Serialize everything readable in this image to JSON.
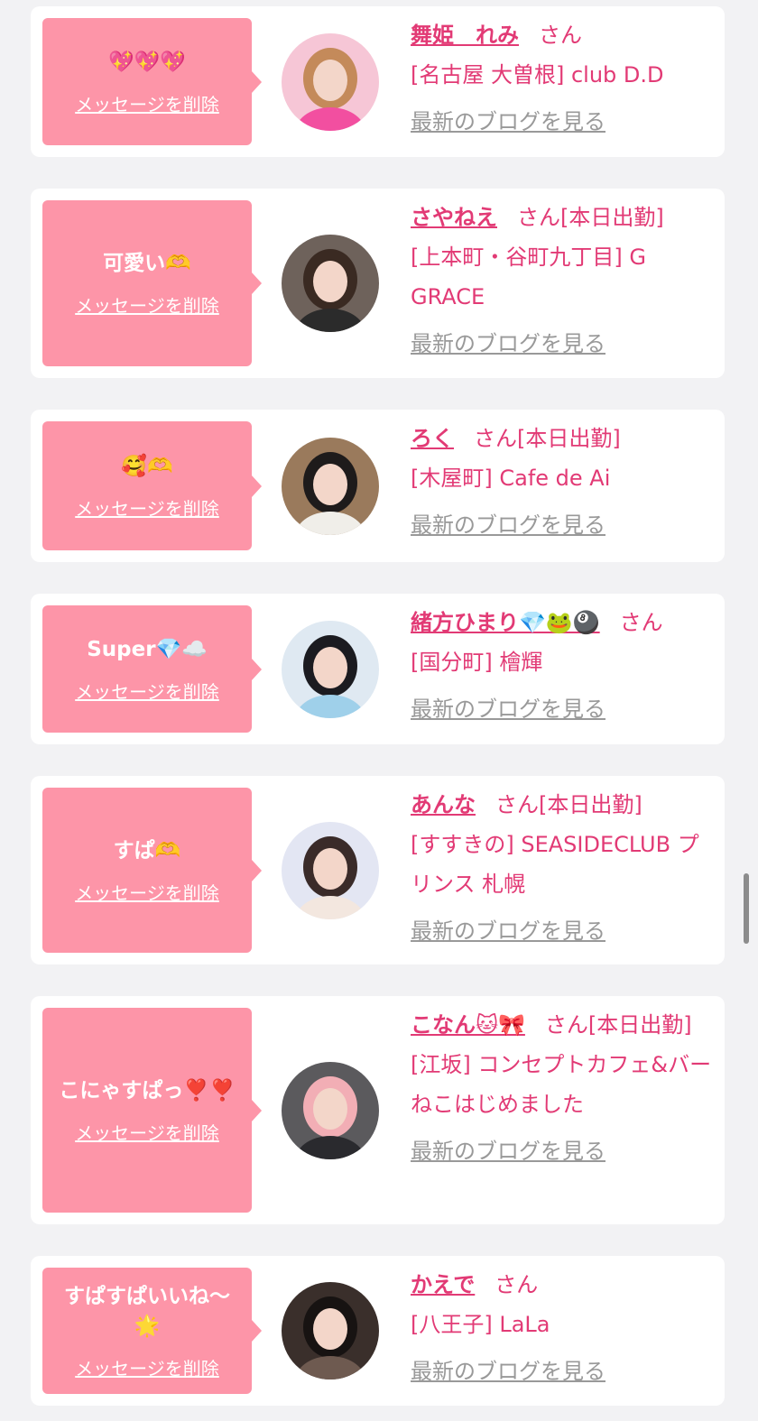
{
  "delete_label": "メッセージを削除",
  "blog_label": "最新のブログを見る",
  "colors": {
    "bubble": "#fd95a8",
    "name": "#e23a75",
    "link_gray": "#999999",
    "background": "#f2f2f4"
  },
  "cards": [
    {
      "message": "💖💖💖",
      "name": "舞姫　れみ",
      "suffix": "さん",
      "shop": "[名古屋 大曽根] club D.D",
      "avatar": {
        "bg": "#f6c6d6",
        "hair": "#c48a5a",
        "outfit": "#f24fa0"
      }
    },
    {
      "message": "可愛い🫶",
      "name": "さやねえ",
      "suffix": "さん[本日出勤]",
      "shop": "[上本町・谷町九丁目] G GRACE",
      "avatar": {
        "bg": "#6e625b",
        "hair": "#3a2a22",
        "outfit": "#2b2b2b"
      }
    },
    {
      "message": "🥰🫶",
      "name": "ろく",
      "suffix": "さん[本日出勤]",
      "shop": "[木屋町] Cafe de Ai",
      "avatar": {
        "bg": "#9a7a5c",
        "hair": "#1e1b1b",
        "outfit": "#f0eee9"
      }
    },
    {
      "message": "Super💎☁️",
      "name": "緒方ひまり💎🐸🎱",
      "suffix": "さん",
      "shop": "[国分町] 檜輝",
      "avatar": {
        "bg": "#dfe9f2",
        "hair": "#1b1b20",
        "outfit": "#9fd0ea"
      }
    },
    {
      "message": "すぱ🫶",
      "name": "あんな",
      "suffix": "さん[本日出勤]",
      "shop": "[すすきの] SEASIDECLUB プリンス 札幌",
      "avatar": {
        "bg": "#e3e6f3",
        "hair": "#3a2b29",
        "outfit": "#f3e7df"
      }
    },
    {
      "message": "こにゃすぱっ❣️❣️",
      "name": "こなん🐱🎀",
      "suffix": "さん[本日出勤]",
      "shop": "[江坂] コンセプトカフェ&バー　ねこはじめました",
      "avatar": {
        "bg": "#5b5a5d",
        "hair": "#f2aeb5",
        "outfit": "#2a2a2e"
      }
    },
    {
      "message": "すぱすぱいいね〜🌟",
      "name": "かえで",
      "suffix": "さん",
      "shop": "[八王子] LaLa",
      "avatar": {
        "bg": "#3a2f2b",
        "hair": "#171312",
        "outfit": "#6e5a50"
      }
    }
  ]
}
